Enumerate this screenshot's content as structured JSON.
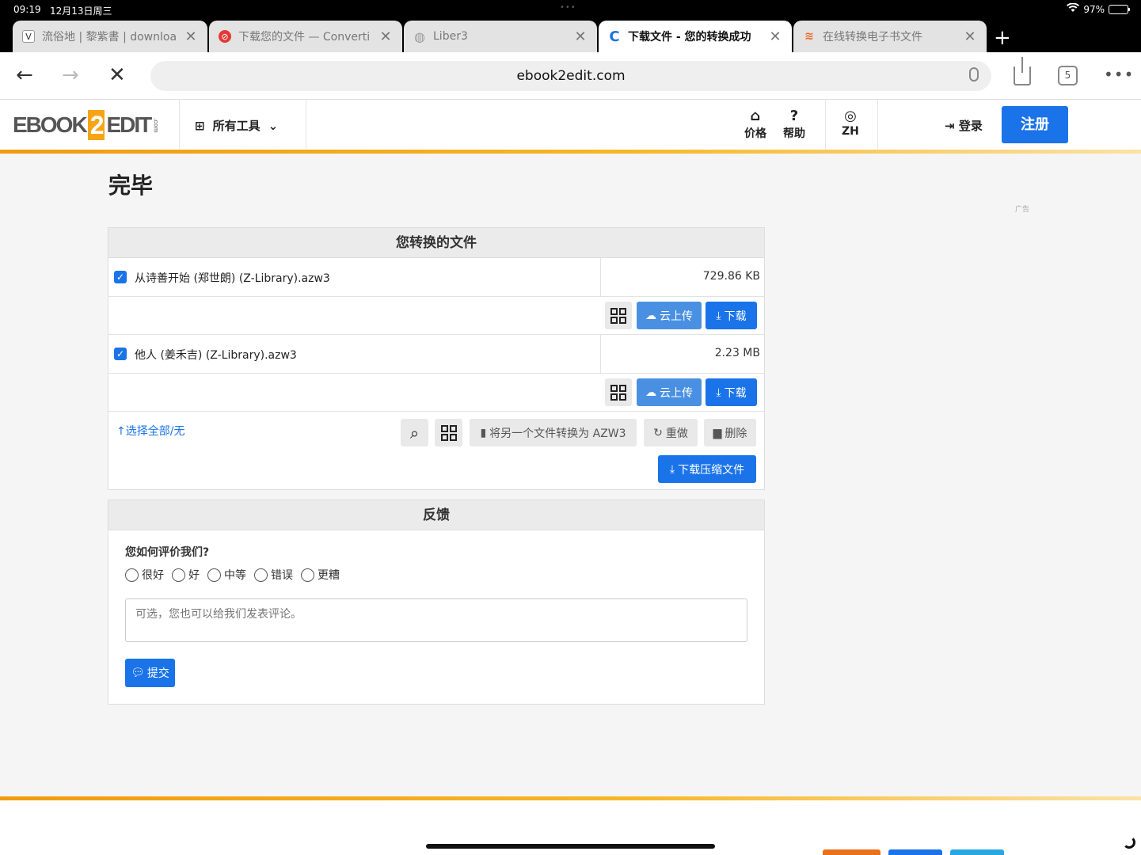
{
  "status": {
    "time": "09:19",
    "date": "12月13日周三",
    "battery": "97%"
  },
  "tabs": [
    {
      "title": "流俗地 | 黎紫書 | downloa",
      "favicon": "V",
      "active": false
    },
    {
      "title": "下载您的文件 — Converti",
      "favicon": "⊘",
      "active": false
    },
    {
      "title": "Liber3",
      "favicon": "◍",
      "active": false
    },
    {
      "title": "下载文件 - 您的转换成功",
      "favicon": "C",
      "active": true
    },
    {
      "title": "在线转换电子书文件",
      "favicon": "≋",
      "active": false
    }
  ],
  "browser": {
    "url": "ebook2edit.com",
    "tab_count": "5"
  },
  "site": {
    "logo_left": "EBOOK",
    "logo_mid": "2",
    "logo_right": "EDIT",
    "logo_com": ".com",
    "all_tools": "所有工具",
    "pricing": "价格",
    "help": "帮助",
    "language": "ZH",
    "login": "登录",
    "register": "注册"
  },
  "page": {
    "title": "完毕",
    "ad_label": "广告"
  },
  "files_panel": {
    "heading": "您转换的文件",
    "files": [
      {
        "name": "从诗善开始 (郑世朗) (Z-Library).azw3",
        "size": "729.86 KB",
        "checked": true
      },
      {
        "name": "他人 (姜禾吉) (Z-Library).azw3",
        "size": "2.23 MB",
        "checked": true
      }
    ],
    "cloud_label": "云上传",
    "download_label": "下载",
    "select_all": "选择全部/无",
    "convert_another": "将另一个文件转换为 AZW3",
    "redo": "重做",
    "delete": "删除",
    "download_zip": "下载压缩文件"
  },
  "feedback": {
    "heading": "反馈",
    "question": "您如何评价我们?",
    "options": [
      "很好",
      "好",
      "中等",
      "错误",
      "更糟"
    ],
    "placeholder": "可选，您也可以给我们发表评论。",
    "submit": "提交"
  },
  "colors": {
    "primary": "#1a73e8",
    "accent": "#f6a416"
  }
}
